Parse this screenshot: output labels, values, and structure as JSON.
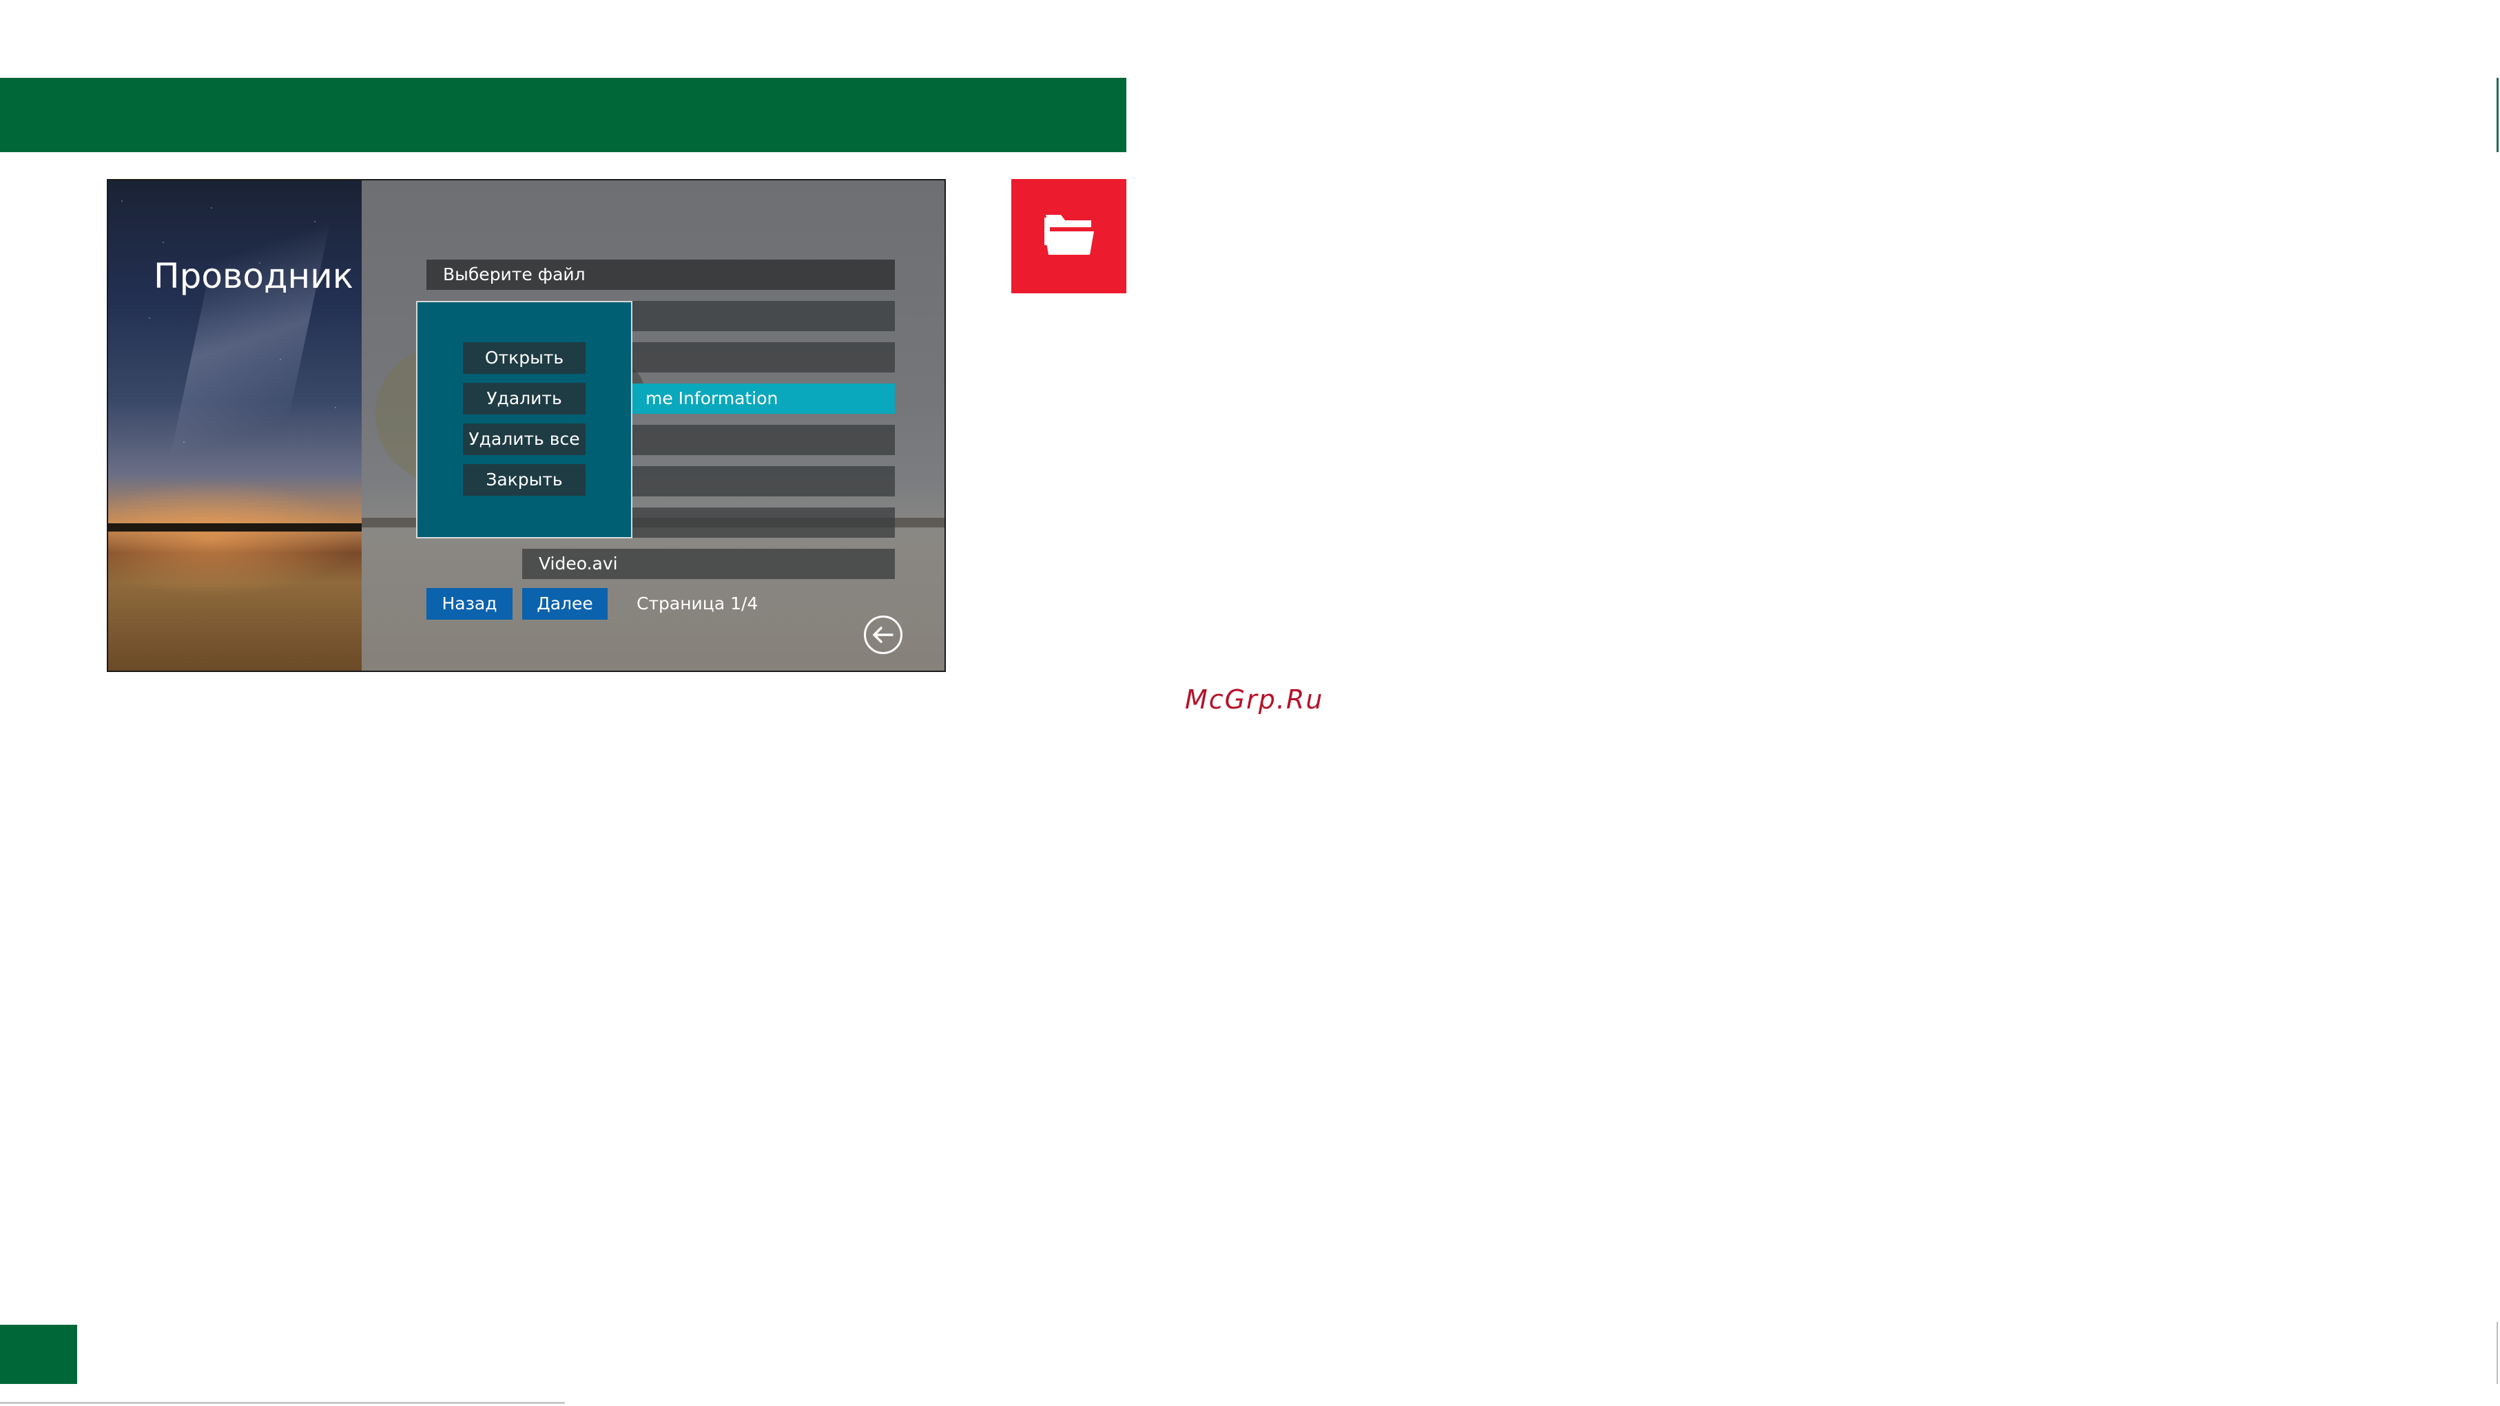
{
  "screen": {
    "title": "Проводник",
    "list_header": "Выберите файл",
    "selected_item": "me Information",
    "last_item": "Video.avi"
  },
  "context_menu": {
    "open": "Открыть",
    "delete": "Удалить",
    "delete_all": "Удалить все",
    "close": "Закрыть"
  },
  "navigation": {
    "back": "Назад",
    "next": "Далее",
    "page": "Страница 1/4"
  },
  "icons": {
    "section_icon": "folder-open-icon",
    "return_icon": "arrow-left-circle-icon"
  },
  "watermark": "McGrp.Ru",
  "colors": {
    "brand_green": "#006838",
    "folder_red": "#ec1c2e",
    "selection_cyan": "#0aa8bc",
    "menu_teal": "#005f73",
    "nav_blue": "#0b62ad"
  }
}
